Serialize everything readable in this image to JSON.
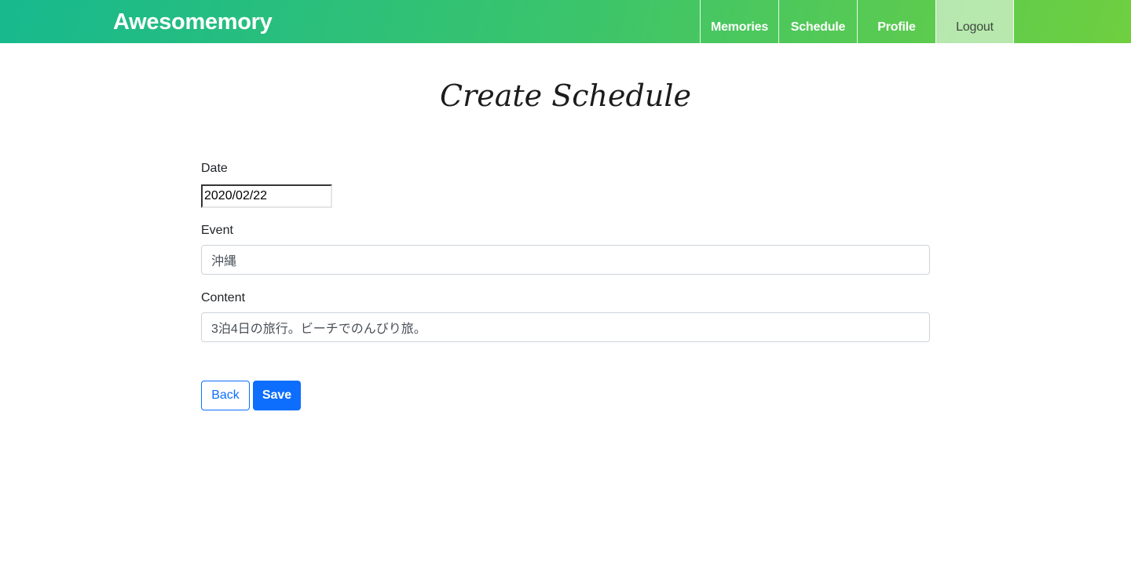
{
  "navbar": {
    "brand": "Awesomemory",
    "items": [
      {
        "label": "Memories"
      },
      {
        "label": "Schedule"
      },
      {
        "label": "Profile"
      },
      {
        "label": "Logout"
      }
    ]
  },
  "page": {
    "title": "Create Schedule"
  },
  "form": {
    "date_label": "Date",
    "date_value": "2020/02/22",
    "event_label": "Event",
    "event_value": "沖縄",
    "content_label": "Content",
    "content_value": "3泊4日の旅行。ビーチでのんびり旅。"
  },
  "buttons": {
    "back_label": "Back",
    "save_label": "Save"
  },
  "colors": {
    "navbar_gradient_start": "#17b98e",
    "navbar_gradient_end": "#6fcf3f",
    "primary": "#0d6efd"
  }
}
